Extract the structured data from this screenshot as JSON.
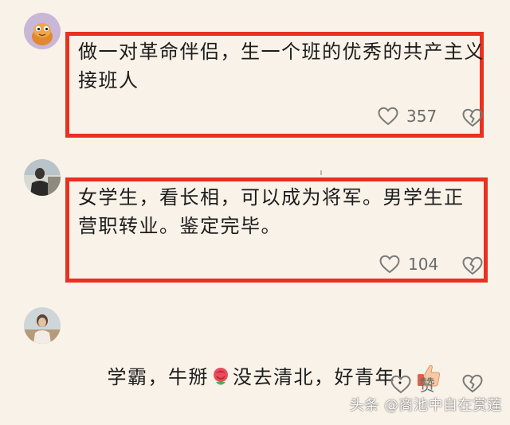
{
  "colors": {
    "background": "#f9f2e8",
    "highlight_border": "#e8311f",
    "icon_gray": "#7a7a7a"
  },
  "comments": [
    {
      "avatar_icon": "cartoon-avatar-icon",
      "text": "做一对革命伴侣，生一个班的优秀的共产主义接班人",
      "like_count": "357",
      "highlighted": true
    },
    {
      "avatar_icon": "photo-avatar-icon",
      "text": "女学生，看长相，可以成为将军。男学生正营职转业。鉴定完毕。",
      "like_count": "104",
      "highlighted": true
    },
    {
      "avatar_icon": "photo-avatar-icon",
      "text_before": "学霸，牛掰",
      "emoji_1": "rose-emoji-icon",
      "text_after": "没去清北，好青年！",
      "emoji_2": "thumbs-up-emoji-icon",
      "like_label": "赞",
      "highlighted": false
    }
  ],
  "watermark": {
    "text": "头条 @商池中自在赏莲"
  }
}
